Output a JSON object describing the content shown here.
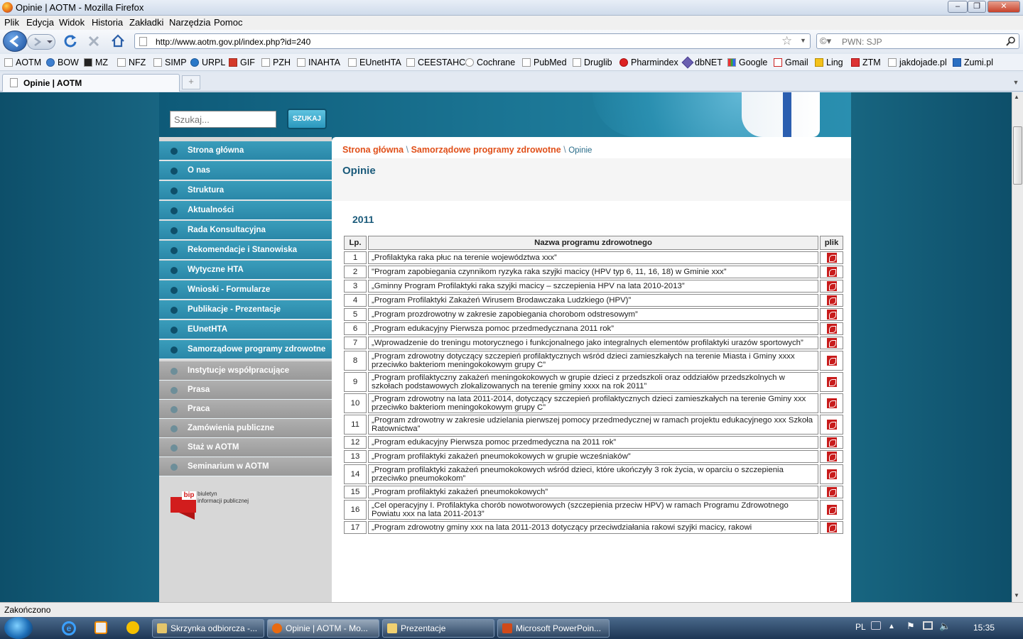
{
  "window": {
    "title": "Opinie | AOTM - Mozilla Firefox",
    "min": "‒",
    "max": "❐",
    "close": "✕"
  },
  "menu": [
    "Plik",
    "Edycja",
    "Widok",
    "Historia",
    "Zakładki",
    "Narzędzia",
    "Pomoc"
  ],
  "nav": {
    "url": "http://www.aotm.gov.pl/index.php?id=240",
    "search_placeholder": "PWN: SJP"
  },
  "bookmarks": [
    "AOTM",
    "BOW",
    "MZ",
    "NFZ",
    "SIMP",
    "URPL",
    "GIF",
    "PZH",
    "INAHTA",
    "EUnetHTA",
    "CEESTAHC",
    "Cochrane",
    "PubMed",
    "Druglib",
    "Pharmindex",
    "dbNET",
    "Google",
    "Gmail",
    "Ling",
    "ZTM",
    "jakdojade.pl",
    "Zumi.pl"
  ],
  "tab": {
    "label": "Opinie | AOTM",
    "new": "+"
  },
  "site": {
    "search_placeholder": "Szukaj...",
    "search_button": "SZUKAJ",
    "menu_blue": [
      "Strona główna",
      "O nas",
      "Struktura",
      "Aktualności",
      "Rada Konsultacyjna",
      "Rekomendacje i Stanowiska",
      "Wytyczne HTA",
      "Wnioski - Formularze",
      "Publikacje - Prezentacje",
      "EUnetHTA",
      "Samorządowe programy zdrowotne"
    ],
    "menu_gray": [
      "Instytucje współpracujące",
      "Prasa",
      "Praca",
      "Zamówienia publiczne",
      "Staż w AOTM",
      "Seminarium w AOTM"
    ],
    "bip": {
      "logo": "bip",
      "line1": "biuletyn",
      "line2": "informacji publicznej"
    },
    "breadcrumb": {
      "home": "Strona główna",
      "section": "Samorządowe programy zdrowotne",
      "current": "Opinie",
      "sep": "\\"
    },
    "page_title": "Opinie",
    "year": "2011",
    "table": {
      "headers": [
        "Lp.",
        "Nazwa programu zdrowotnego",
        "plik"
      ],
      "rows": [
        [
          "1",
          "„Profilaktyka raka płuc na terenie województwa xxx”"
        ],
        [
          "2",
          "\"Program zapobiegania czynnikom ryzyka raka szyjki macicy (HPV typ 6, 11, 16, 18) w Gminie xxx”"
        ],
        [
          "3",
          "„Gminny Program Profilaktyki raka szyjki macicy – szczepienia HPV na lata 2010-2013”"
        ],
        [
          "4",
          "„Program Profilaktyki Zakażeń Wirusem Brodawczaka Ludzkiego (HPV)”"
        ],
        [
          "5",
          "„Program prozdrowotny w zakresie zapobiegania chorobom odstresowym”"
        ],
        [
          "6",
          "„Program edukacyjny Pierwsza pomoc przedmedycznana 2011 rok”"
        ],
        [
          "7",
          "„Wprowadzenie do treningu motorycznego i funkcjonalnego jako integralnych elementów profilaktyki urazów sportowych”"
        ],
        [
          "8",
          "„Program zdrowotny dotyczący szczepień profilaktycznych wśród dzieci zamieszkałych na terenie Miasta i Gminy xxxx przeciwko bakteriom meningokokowym grupy C”"
        ],
        [
          "9",
          "„Program profilaktyczny zakażeń meningokokowych w grupie dzieci z przedszkoli oraz oddziałów przedszkolnych w szkołach podstawowych zlokalizowanych na terenie gminy xxxx na rok 2011”"
        ],
        [
          "10",
          "„Program zdrowotny na lata 2011-2014, dotyczący szczepień profilaktycznych dzieci zamieszkałych na terenie Gminy xxx przeciwko bakteriom meningokokowym grupy C”"
        ],
        [
          "11",
          "„Program zdrowotny w zakresie udzielania pierwszej pomocy przedmedycznej w ramach projektu edukacyjnego xxx Szkoła Ratownictwa”"
        ],
        [
          "12",
          "„Program edukacyjny Pierwsza pomoc przedmedyczna na 2011 rok”"
        ],
        [
          "13",
          "„Program profilaktyki zakażeń pneumokokowych w grupie wcześniaków”"
        ],
        [
          "14",
          "„Program profilaktyki zakażeń pneumokokowych wśród dzieci, które ukończyły 3 rok życia, w oparciu o szczepienia przeciwko pneumokokom”"
        ],
        [
          "15",
          "„Program profilaktyki zakażeń pneumokokowych”"
        ],
        [
          "16",
          "„Cel operacyjny I. Profilaktyka chorób nowotworowych (szczepienia przeciw HPV) w ramach Programu Zdrowotnego Powiatu xxx na lata 2011-2013”"
        ],
        [
          "17",
          "„Program zdrowotny gminy xxx na lata 2011-2013 dotyczący przeciwdziałania rakowi szyjki macicy, rakowi"
        ]
      ]
    }
  },
  "status": "Zakończono",
  "taskbar": {
    "tasks": [
      "Skrzynka odbiorcza -...",
      "Opinie | AOTM - Mo...",
      "Prezentacje",
      "Microsoft PowerPoin..."
    ],
    "lang": "PL",
    "time": "15:35"
  },
  "colors": {
    "accent_red": "#e0501a",
    "teal": "#1b6b88",
    "title_blue": "#0e5a78"
  }
}
